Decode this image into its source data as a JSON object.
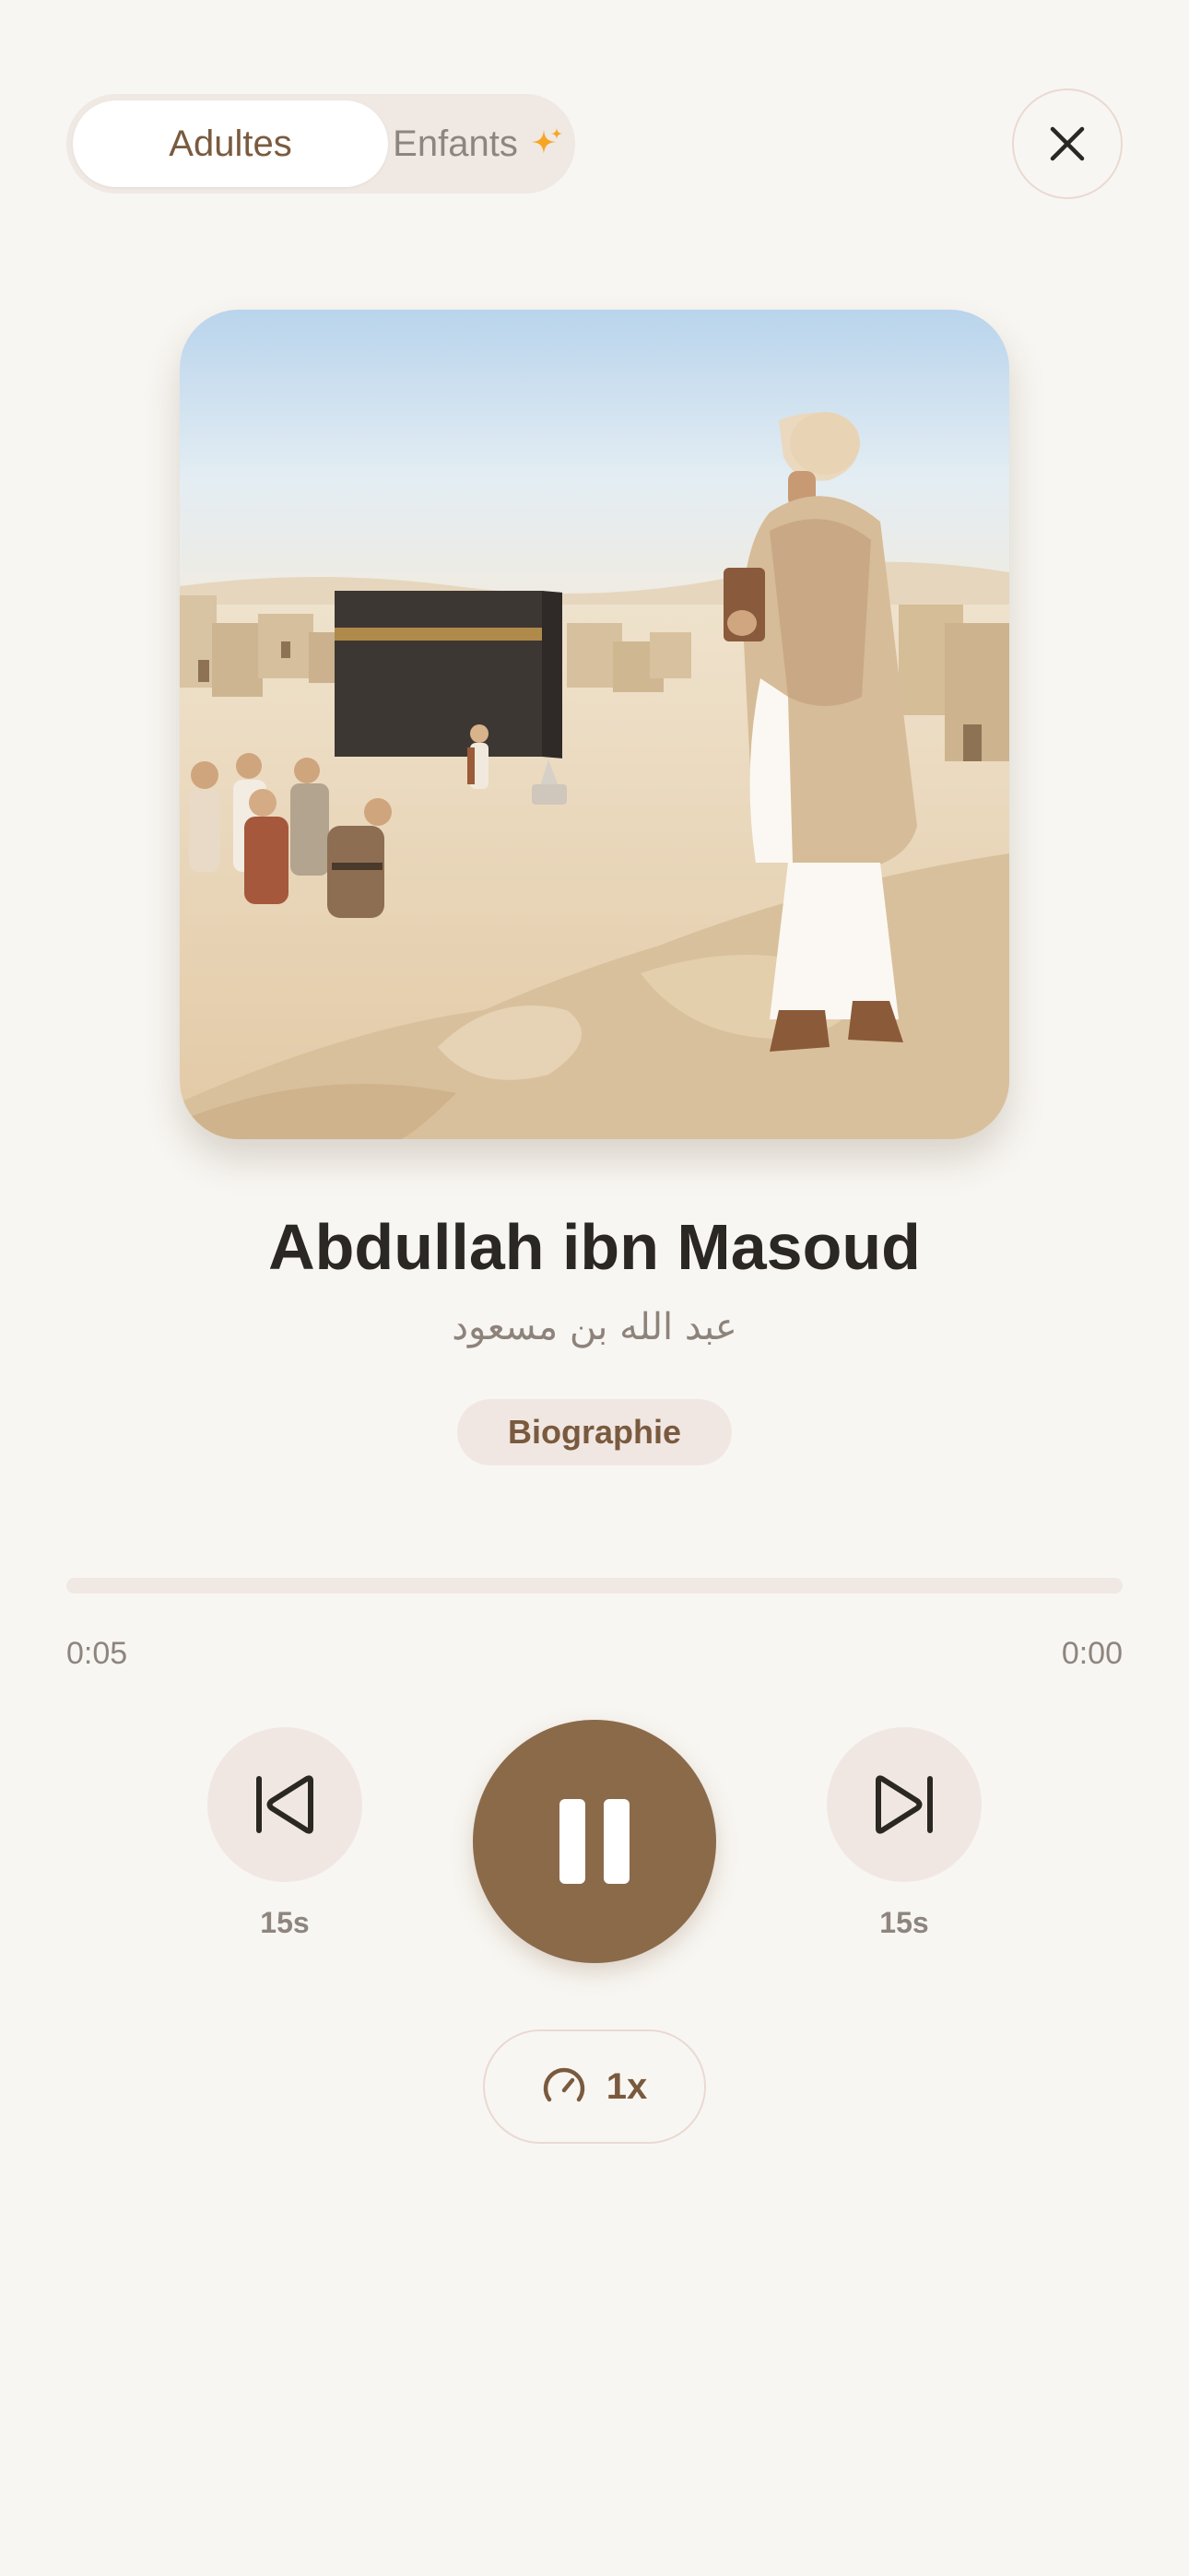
{
  "audience_toggle": {
    "active_label": "Adultes",
    "inactive_label": "Enfants",
    "inactive_icon": "sparkle-icon",
    "accent_color": "#f5a623"
  },
  "close_icon": "close-icon",
  "artwork": {
    "icon": "kaaba-illustration"
  },
  "track": {
    "title": "Abdullah ibn Masoud",
    "subtitle_arabic": "عبد الله بن مسعود",
    "category": "Biographie"
  },
  "progress": {
    "elapsed": "0:05",
    "total": "0:00",
    "fraction": 0
  },
  "controls": {
    "skip_back_label": "15s",
    "skip_forward_label": "15s",
    "state": "playing",
    "speed_label": "1x"
  },
  "colors": {
    "background": "#f8f6f2",
    "primary_brown": "#8b6a4a",
    "soft_chip": "#f1e7e2"
  }
}
